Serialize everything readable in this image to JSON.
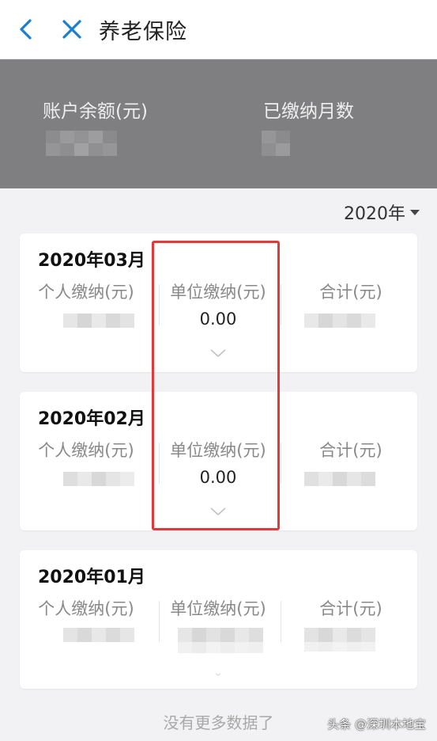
{
  "header": {
    "title": "养老保险"
  },
  "summary": {
    "balance_label": "账户余额(元)",
    "months_label": "已缴纳月数"
  },
  "filter": {
    "year_label": "2020年"
  },
  "columns": [
    "个人缴纳(元)",
    "单位缴纳(元)",
    "合计(元)"
  ],
  "records": [
    {
      "month": "2020年03月",
      "employer_amount": "0.00"
    },
    {
      "month": "2020年02月",
      "employer_amount": "0.00"
    },
    {
      "month": "2020年01月",
      "employer_amount": ""
    }
  ],
  "footer": {
    "no_more_text": "没有更多数据了",
    "watermark": "头条 @深圳本地宝"
  },
  "colors": {
    "summary_bg": "#7f7f81",
    "accent": "#1a7fd1",
    "highlight": "#e03a3a"
  }
}
